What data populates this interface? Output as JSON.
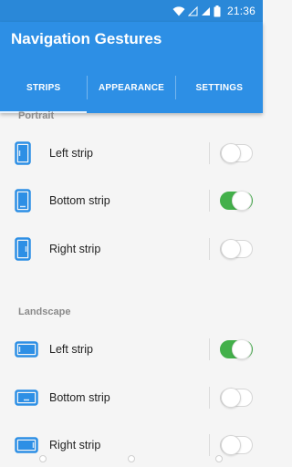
{
  "status_bar": {
    "time": "21:36",
    "icons": [
      "wifi-icon",
      "signal-empty-icon",
      "signal-icon",
      "battery-icon"
    ]
  },
  "app": {
    "title": "Navigation Gestures",
    "accent_color": "#2d8fe5",
    "switch_on_color": "#43b04a"
  },
  "tabs": [
    {
      "label": "STRIPS",
      "active": true
    },
    {
      "label": "APPEARANCE",
      "active": false
    },
    {
      "label": "SETTINGS",
      "active": false
    }
  ],
  "sections": [
    {
      "title": "Portrait",
      "items": [
        {
          "label": "Left strip",
          "icon": "phone-portrait-left-strip-icon",
          "enabled": false
        },
        {
          "label": "Bottom strip",
          "icon": "phone-portrait-bottom-strip-icon",
          "enabled": true
        },
        {
          "label": "Right strip",
          "icon": "phone-portrait-right-strip-icon",
          "enabled": false
        }
      ]
    },
    {
      "title": "Landscape",
      "items": [
        {
          "label": "Left strip",
          "icon": "phone-landscape-left-strip-icon",
          "enabled": true
        },
        {
          "label": "Bottom strip",
          "icon": "phone-landscape-bottom-strip-icon",
          "enabled": false
        },
        {
          "label": "Right strip",
          "icon": "phone-landscape-right-strip-icon",
          "enabled": false
        }
      ]
    }
  ]
}
